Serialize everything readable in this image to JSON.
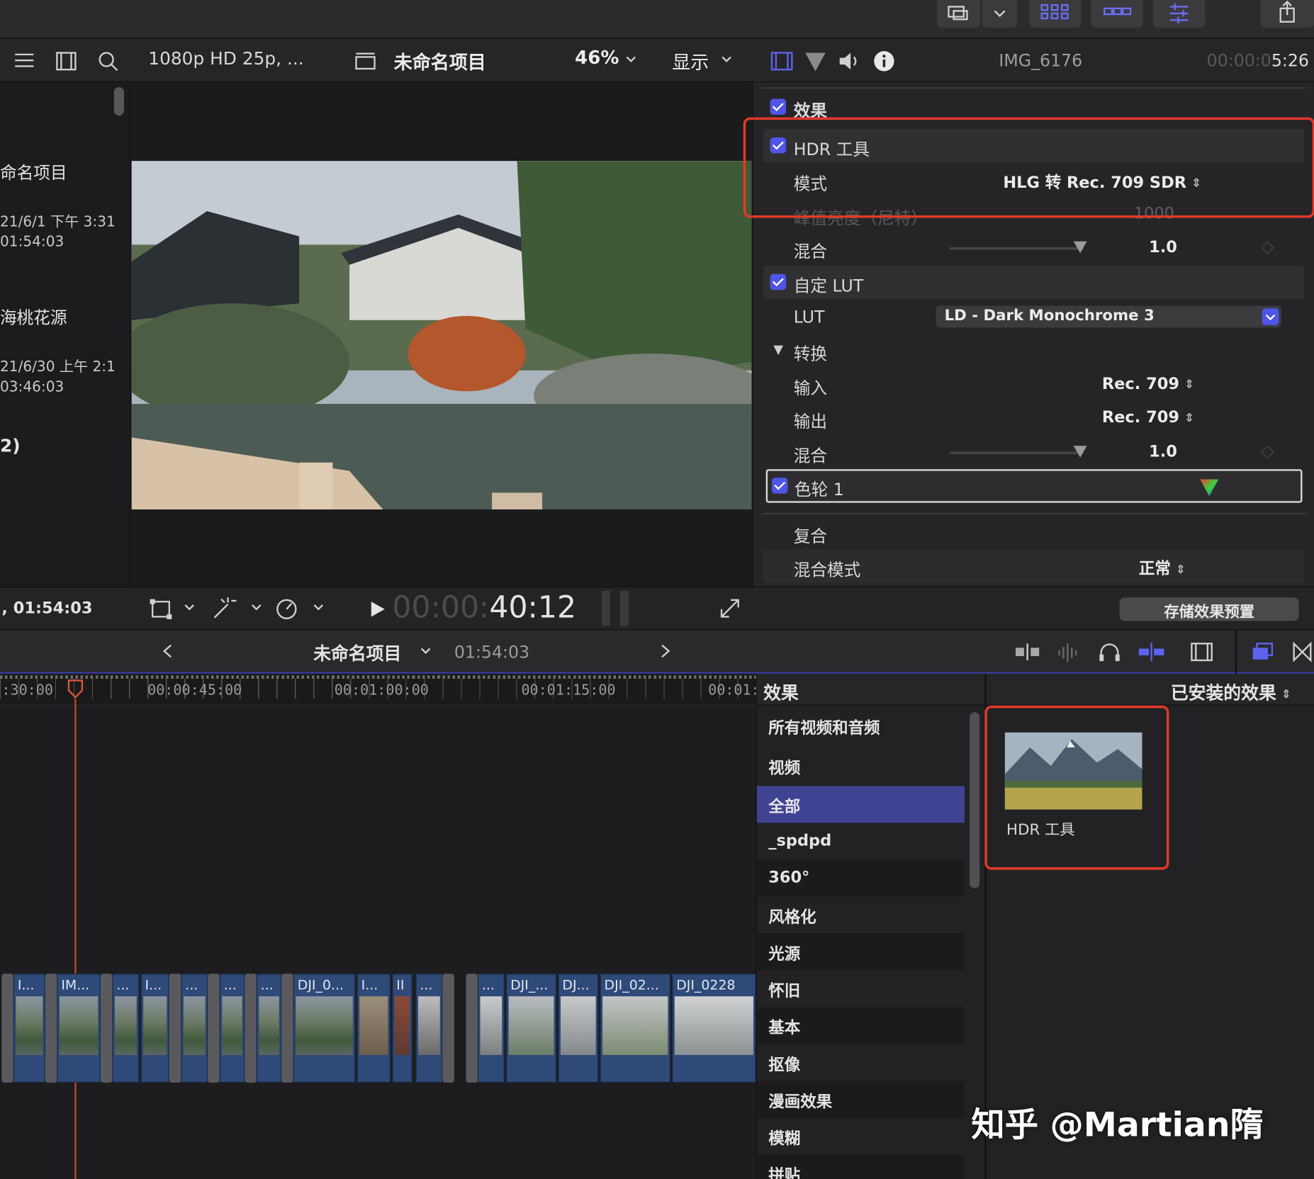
{
  "toolbar": {
    "format": "1080p HD 25p, ...",
    "project_name": "未命名项目",
    "zoom": "46%",
    "view_label": "显示"
  },
  "library": {
    "items": [
      {
        "name": "命名项目",
        "date": "21/6/1 下午 3:31",
        "duration": "01:54:03"
      },
      {
        "name": "海桃花源",
        "date": "21/6/30 上午 2:1",
        "duration": "03:46:03"
      }
    ],
    "count": "2)",
    "footer_time": ", 01:54:03"
  },
  "inspector": {
    "clip_name": "IMG_6176",
    "duration_dim": "00:00:0",
    "duration": "5:26",
    "effects_label": "效果",
    "hdr_tools": "HDR 工具",
    "mode_label": "模式",
    "mode_value": "HLG 转 Rec. 709 SDR",
    "peak_label": "峰值亮度（尼特）",
    "peak_value": "1000",
    "mix_label": "混合",
    "mix_value": "1.0",
    "custom_lut": "自定 LUT",
    "lut_label": "LUT",
    "lut_value": "LD - Dark Monochrome 3",
    "convert_label": "转换",
    "input_label": "输入",
    "input_value": "Rec. 709",
    "output_label": "输出",
    "output_value": "Rec. 709",
    "mix2_label": "混合",
    "mix2_value": "1.0",
    "color_wheel": "色轮 1",
    "composite_label": "复合",
    "blend_mode_label": "混合模式",
    "blend_mode_value": "正常",
    "save_preset": "存储效果预置"
  },
  "transport": {
    "timecode_dim": "00:00:",
    "timecode": "40:12"
  },
  "timeline_header": {
    "project_name": "未命名项目",
    "duration": "01:54:03"
  },
  "ruler": {
    "labels": [
      ":30:00",
      "00:00:45:00",
      "00:01:00:00",
      "00:01:15:00",
      "00:01:"
    ]
  },
  "clips": [
    "I...",
    "IM...",
    "...",
    "I...",
    "...",
    "...",
    "...",
    "DJI_0...",
    "I...",
    "II",
    "...",
    "...",
    "DJI_...",
    "DJ...",
    "DJI_02...",
    "DJI_0228"
  ],
  "effects_browser": {
    "title": "效果",
    "installed": "已安装的效果",
    "categories": [
      "所有视频和音频",
      "视频",
      "全部",
      "_spdpd",
      "360°",
      "风格化",
      "光源",
      "怀旧",
      "基本",
      "抠像",
      "漫画效果",
      "模糊",
      "拼贴"
    ],
    "tile_label": "HDR 工具"
  },
  "watermark": "知乎 @Martian隋",
  "colors": {
    "accent": "#4f55e6",
    "highlight": "#e2382c",
    "selected": "#404392",
    "clip": "#2f4a78"
  }
}
